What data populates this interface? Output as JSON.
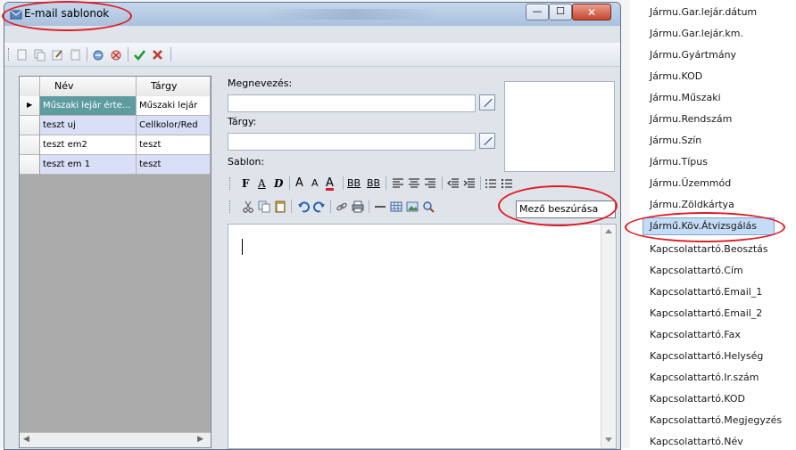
{
  "window": {
    "title": "E-mail sablonok",
    "min_symbol": "—",
    "max_symbol": "☐",
    "close_symbol": "✕"
  },
  "toolbar": {
    "icons": [
      "new-icon",
      "copy-icon",
      "edit-icon",
      "paste-icon",
      "send-icon",
      "delete-icon",
      "confirm-icon",
      "cancel-icon"
    ]
  },
  "grid": {
    "columns": [
      "Név",
      "Tárgy"
    ],
    "rows": [
      {
        "nev": "Műszaki lejár érte...",
        "targy": "Műszaki lejár",
        "current": true
      },
      {
        "nev": "teszt uj",
        "targy": "Cellkolor/Red",
        "current": false
      },
      {
        "nev": "teszt em2",
        "targy": "teszt",
        "current": false
      },
      {
        "nev": "teszt em 1",
        "targy": "teszt",
        "current": false
      }
    ],
    "current_marker": "▶",
    "scroll_left": "◀",
    "scroll_right": "▶"
  },
  "form": {
    "name_label": "Megnevezés:",
    "subject_label": "Tárgy:",
    "template_label": "Sablon:",
    "name_value": "",
    "subject_value": ""
  },
  "format_bar": {
    "bold": "F",
    "underline": "A",
    "italic": "D",
    "font_size_up": "A",
    "font_size_down": "A",
    "font_color": "A",
    "sub": "BB",
    "sup": "BB"
  },
  "insert_field": {
    "label": "Mező beszúrása"
  },
  "field_list": {
    "items": [
      "Jármu.Gar.lejár.dátum",
      "Jármu.Gar.lejár.km.",
      "Jármu.Gyártmány",
      "Jármu.KOD",
      "Jármu.Műszaki",
      "Jármu.Rendszám",
      "Jármu.Szín",
      "Jármu.Típus",
      "Jármu.Üzemmód",
      "Jármu.Zöldkártya",
      "Jármű.Köv.Átvizsgálás",
      "Kapcsolattartó.Beosztás",
      "Kapcsolattartó.Cím",
      "Kapcsolattartó.Email_1",
      "Kapcsolattartó.Email_2",
      "Kapcsolattartó.Fax",
      "Kapcsolattartó.Helység",
      "Kapcsolattartó.Ir.szám",
      "Kapcsolattartó.KOD",
      "Kapcsolattartó.Megjegyzés",
      "Kapcsolattartó.Név"
    ],
    "selected_index": 10
  },
  "colors": {
    "highlight_ring": "#e01b24",
    "grid_current_row": "#5e9ca0",
    "grid_row_alt": "#d9dff7",
    "selection": "#c5dcf7"
  }
}
